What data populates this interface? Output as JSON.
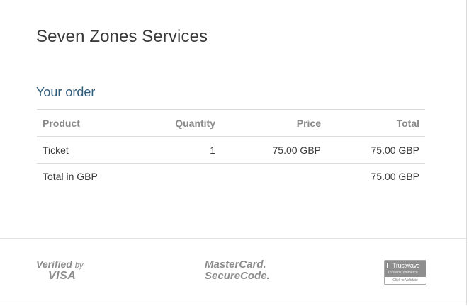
{
  "merchant": {
    "name": "Seven Zones Services"
  },
  "order": {
    "heading": "Your order",
    "columns": {
      "product": "Product",
      "quantity": "Quantity",
      "price": "Price",
      "total": "Total"
    },
    "items": [
      {
        "product": "Ticket",
        "quantity": "1",
        "price": "75.00 GBP",
        "total": "75.00 GBP"
      }
    ],
    "grand_total": {
      "label": "Total in GBP",
      "value": "75.00 GBP"
    }
  },
  "footer": {
    "visa": {
      "line1": "Verified",
      "by": "by",
      "line2": "VISA"
    },
    "mastercard": {
      "line1": "MasterCard.",
      "line2": "SecureCode."
    },
    "trustwave": {
      "name": "Trustwave",
      "subtitle": "Trusted Commerce",
      "cta": "Click to Validate"
    }
  },
  "colors": {
    "heading_accent": "#2f5b7a",
    "text": "#3a3a3a",
    "muted": "#8a8a8a",
    "border": "#dcdcdc"
  }
}
